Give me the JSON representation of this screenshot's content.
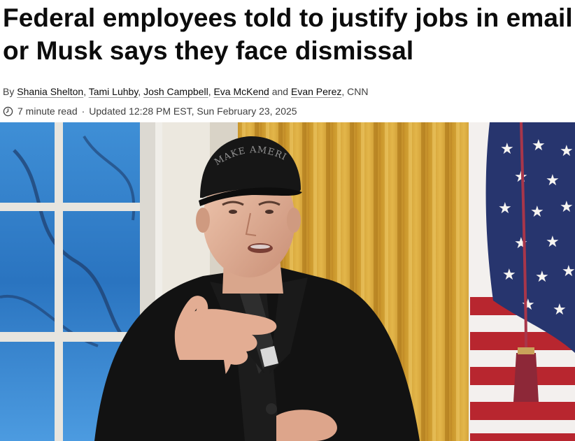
{
  "article": {
    "headline": "Federal employees told to justify jobs in email or Musk says they face dismissal",
    "byline_prefix": "By",
    "authors": [
      "Shania Shelton",
      "Tami Luhby",
      "Josh Campbell",
      "Eva McKend",
      "Evan Perez"
    ],
    "byline_and": "and",
    "source": "CNN",
    "read_time": "7 minute read",
    "updated": "Updated 12:28 PM EST, Sun February 23, 2025"
  },
  "hero_image": {
    "hat_text": "MAKE AMERICA GREAT AGAIN"
  },
  "colors": {
    "text": "#0c0c0c",
    "meta": "#404040",
    "curtain": "#d8a93a",
    "flag_red": "#b8262f",
    "flag_blue": "#27356e"
  },
  "icons": {
    "read_time": "clock-icon"
  }
}
